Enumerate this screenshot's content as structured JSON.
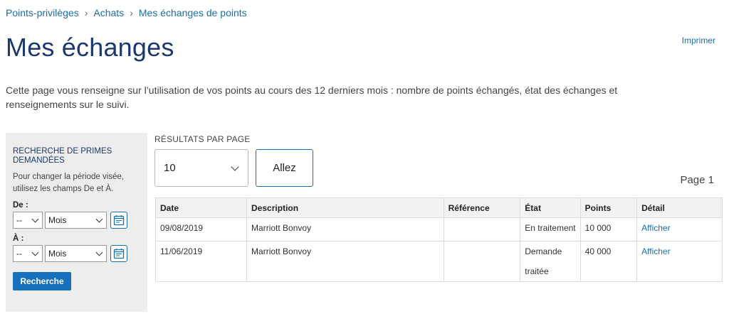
{
  "breadcrumb": [
    {
      "label": "Points-privilèges"
    },
    {
      "label": "Achats"
    },
    {
      "label": "Mes échanges de points"
    }
  ],
  "page": {
    "title": "Mes échanges",
    "print_label": "Imprimer",
    "intro": "Cette page vous renseigne sur l’utilisation de vos points au cours des 12 derniers mois : nombre de points échangés, état des échanges et renseignements sur le suivi."
  },
  "sidebar": {
    "title": "RECHERCHE DE PRIMES DEMANDÉES",
    "help": "Pour changer la période visée, utilisez les champs De et À.",
    "from_label": "De :",
    "to_label": "À :",
    "from_day": "--",
    "from_month": "Mois",
    "to_day": "--",
    "to_month": "Mois",
    "search_label": "Recherche"
  },
  "results": {
    "per_page_label": "RÉSULTATS PAR PAGE",
    "per_page_value": "10",
    "go_label": "Allez",
    "page_label": "Page 1",
    "columns": [
      "Date",
      "Description",
      "Référence",
      "État",
      "Points",
      "Détail"
    ],
    "rows": [
      {
        "date": "09/08/2019",
        "description": "Marriott Bonvoy",
        "reference": "",
        "state": "En traitement",
        "points": "10 000",
        "detail": "Afficher"
      },
      {
        "date": "11/06/2019",
        "description": "Marriott Bonvoy",
        "reference": "",
        "state": "Demande traitée",
        "points": "40 000",
        "detail": "Afficher"
      }
    ]
  },
  "colors": {
    "link": "#1a6fa8",
    "title": "#1b3a6b",
    "primary_button": "#1670bd",
    "sidebar_bg": "#ededed"
  },
  "icons": {
    "calendar": "calendar-icon",
    "chevron": "chevron-down-icon"
  }
}
